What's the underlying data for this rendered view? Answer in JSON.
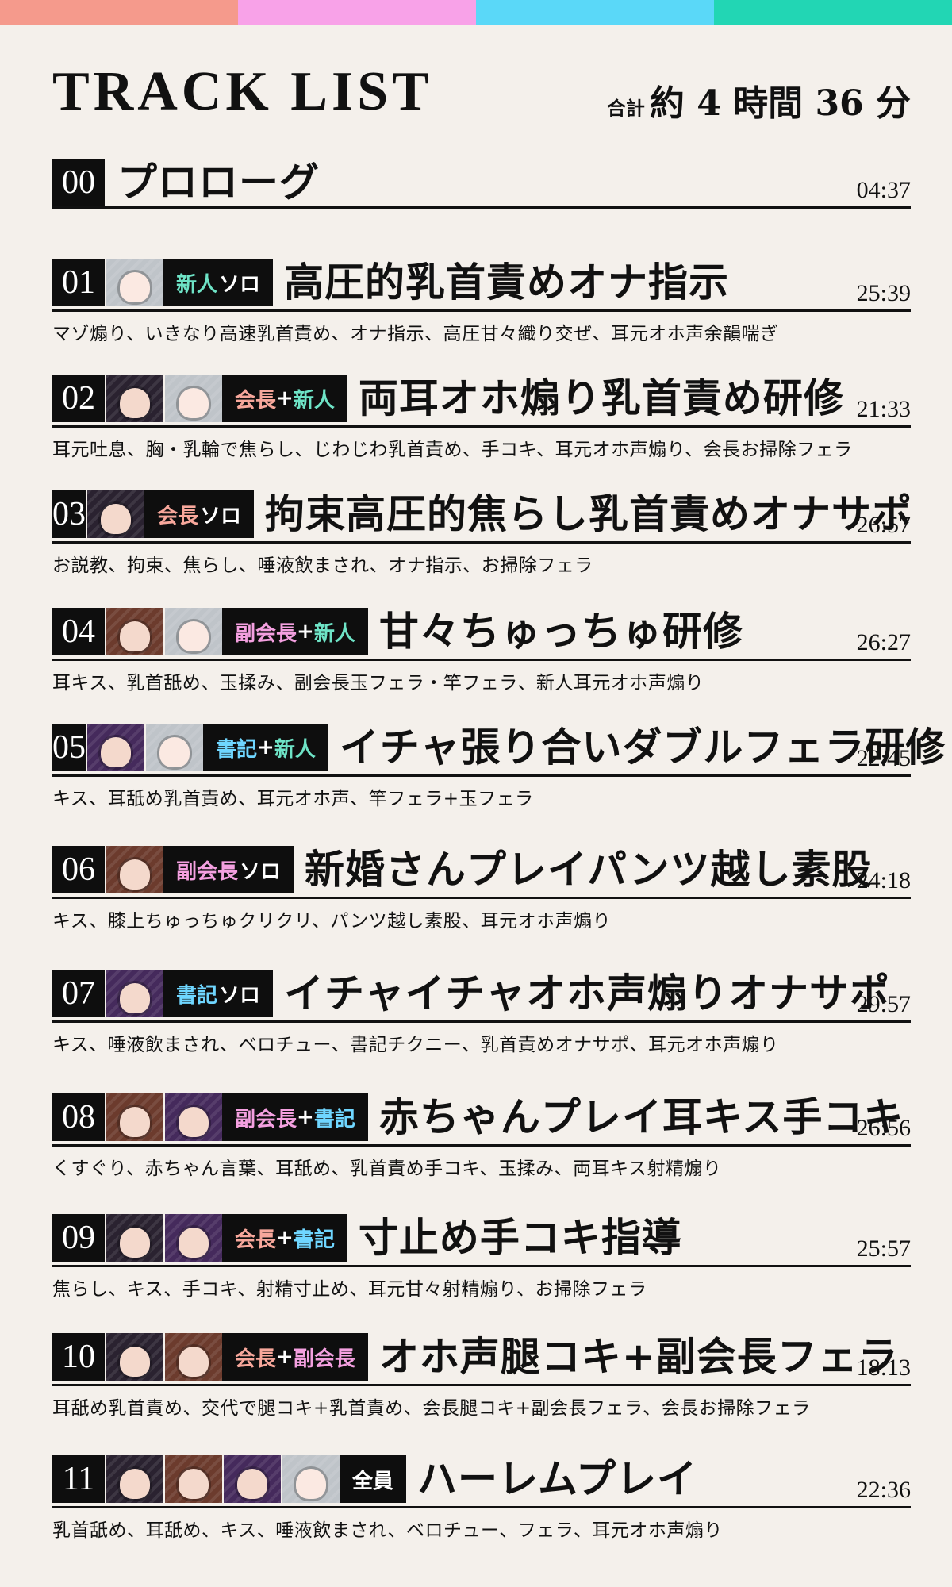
{
  "colors": {
    "topbar": [
      "#f59a8c",
      "#f8a2e8",
      "#5ad8f8",
      "#22d6b4"
    ],
    "role_colors": {
      "kaicho": "#f7a79b",
      "shinjin": "#6ee3c6",
      "fuku": "#f4a0e0",
      "shoki": "#6fd6ff",
      "all": "#ffffff"
    }
  },
  "header": {
    "title": "TRACK LIST",
    "total_label": "合計",
    "total_value": "約 4 時間 36 分"
  },
  "tracks": [
    {
      "num": "00",
      "chars": [],
      "role": [],
      "title": "プロローグ",
      "time": "04:37",
      "desc": ""
    },
    {
      "num": "01",
      "chars": [
        "shinjin"
      ],
      "role": [
        {
          "text": "新人",
          "c": "shinjin"
        },
        {
          "text": "ソロ",
          "c": "solo"
        }
      ],
      "title": "高圧的乳首責めオナ指示",
      "time": "25:39",
      "desc": "マゾ煽り、いきなり高速乳首責め、オナ指示、高圧甘々織り交ぜ、耳元オホ声余韻喘ぎ"
    },
    {
      "num": "02",
      "chars": [
        "kaicho",
        "shinjin"
      ],
      "role": [
        {
          "text": "会長",
          "c": "kaicho"
        },
        {
          "text": "+",
          "c": "sep"
        },
        {
          "text": "新人",
          "c": "shinjin"
        }
      ],
      "title": "両耳オホ煽り乳首責め研修",
      "time": "21:33",
      "desc": "耳元吐息、胸・乳輪で焦らし、じわじわ乳首責め、手コキ、耳元オホ声煽り、会長お掃除フェラ"
    },
    {
      "num": "03",
      "chars": [
        "kaicho"
      ],
      "role": [
        {
          "text": "会長",
          "c": "kaicho"
        },
        {
          "text": "ソロ",
          "c": "solo"
        }
      ],
      "title": "拘束高圧的焦らし乳首責めオナサポ",
      "time": "26:57",
      "desc": "お説教、拘束、焦らし、唾液飲まされ、オナ指示、お掃除フェラ"
    },
    {
      "num": "04",
      "chars": [
        "fuku",
        "shinjin"
      ],
      "role": [
        {
          "text": "副会長",
          "c": "fuku"
        },
        {
          "text": "+",
          "c": "sep"
        },
        {
          "text": "新人",
          "c": "shinjin"
        }
      ],
      "title": "甘々ちゅっちゅ研修",
      "time": "26:27",
      "desc": "耳キス、乳首舐め、玉揉み、副会長玉フェラ・竿フェラ、新人耳元オホ声煽り"
    },
    {
      "num": "05",
      "chars": [
        "shoki",
        "shinjin"
      ],
      "role": [
        {
          "text": "書記",
          "c": "shoki"
        },
        {
          "text": "+",
          "c": "sep"
        },
        {
          "text": "新人",
          "c": "shinjin"
        }
      ],
      "title": "イチャ張り合いダブルフェラ研修",
      "time": "22:45",
      "desc": "キス、耳舐め乳首責め、耳元オホ声、竿フェラ+玉フェラ"
    },
    {
      "num": "06",
      "chars": [
        "fuku"
      ],
      "role": [
        {
          "text": "副会長",
          "c": "fuku"
        },
        {
          "text": "ソロ",
          "c": "solo"
        }
      ],
      "title": "新婚さんプレイパンツ越し素股",
      "time": "24:18",
      "desc": "キス、膝上ちゅっちゅクリクリ、パンツ越し素股、耳元オホ声煽り"
    },
    {
      "num": "07",
      "chars": [
        "shoki"
      ],
      "role": [
        {
          "text": "書記",
          "c": "shoki"
        },
        {
          "text": "ソロ",
          "c": "solo"
        }
      ],
      "title": "イチャイチャオホ声煽りオナサポ",
      "time": "29:57",
      "desc": "キス、唾液飲まされ、ベロチュー、書記チクニー、乳首責めオナサポ、耳元オホ声煽り"
    },
    {
      "num": "08",
      "chars": [
        "fuku",
        "shoki"
      ],
      "role": [
        {
          "text": "副会長",
          "c": "fuku"
        },
        {
          "text": "+",
          "c": "sep"
        },
        {
          "text": "書記",
          "c": "shoki"
        }
      ],
      "title": "赤ちゃんプレイ耳キス手コキ",
      "time": "26:56",
      "desc": "くすぐり、赤ちゃん言葉、耳舐め、乳首責め手コキ、玉揉み、両耳キス射精煽り"
    },
    {
      "num": "09",
      "chars": [
        "kaicho",
        "shoki"
      ],
      "role": [
        {
          "text": "会長",
          "c": "kaicho"
        },
        {
          "text": "+",
          "c": "sep"
        },
        {
          "text": "書記",
          "c": "shoki"
        }
      ],
      "title": "寸止め手コキ指導",
      "time": "25:57",
      "desc": "焦らし、キス、手コキ、射精寸止め、耳元甘々射精煽り、お掃除フェラ"
    },
    {
      "num": "10",
      "chars": [
        "kaicho",
        "fuku"
      ],
      "role": [
        {
          "text": "会長",
          "c": "kaicho"
        },
        {
          "text": "+",
          "c": "sep"
        },
        {
          "text": "副会長",
          "c": "fuku"
        }
      ],
      "title": "オホ声腿コキ+副会長フェラ",
      "time": "18:13",
      "desc": "耳舐め乳首責め、交代で腿コキ+乳首責め、会長腿コキ+副会長フェラ、会長お掃除フェラ"
    },
    {
      "num": "11",
      "chars": [
        "kaicho",
        "fuku",
        "shoki",
        "shinjin"
      ],
      "role": [
        {
          "text": "全員",
          "c": "all"
        }
      ],
      "title": "ハーレムプレイ",
      "time": "22:36",
      "desc": "乳首舐め、耳舐め、キス、唾液飲まされ、ベロチュー、フェラ、耳元オホ声煽り"
    }
  ]
}
